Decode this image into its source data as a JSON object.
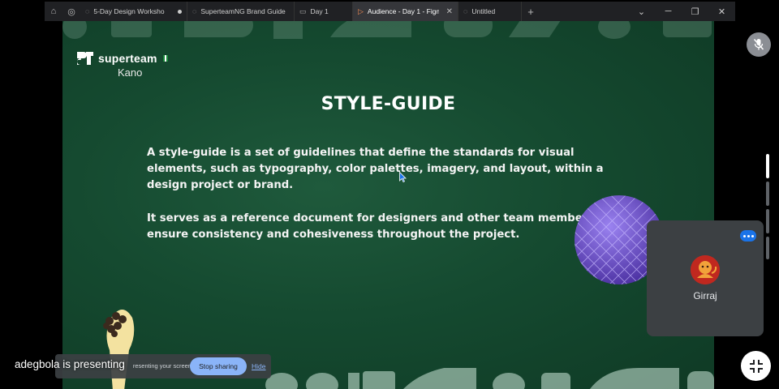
{
  "browser": {
    "tabs": [
      {
        "label": "5-Day Design Worksho",
        "icon": "globe-icon",
        "status": "loading"
      },
      {
        "label": "SuperteamNG Brand Guide",
        "icon": "globe-icon"
      },
      {
        "label": "Day 1",
        "icon": "document-icon"
      },
      {
        "label": "Audience - Day 1 - Figm",
        "icon": "figma-icon",
        "active": true
      },
      {
        "label": "Untitled",
        "icon": "globe-icon"
      }
    ],
    "new_tab_symbol": "+",
    "window_controls": [
      "⌄",
      "─",
      "❐",
      "✕"
    ]
  },
  "slide": {
    "brand": "superteam",
    "brand_sub": "Kano",
    "title": "STYLE-GUIDE",
    "paragraph1": "A style-guide is a set of guidelines that define the standards for visual elements, such as typography, color palettes, imagery, and layout, within a design project or brand.",
    "paragraph2": "It serves as a reference document for designers and other team members to ensure consistency and cohesiveness throughout the project.",
    "colors": {
      "background": "#154a30",
      "deco_shapes": "#cfe9db",
      "mesh_ball": "#7b5cd6",
      "flag_green": "#1b8a3c"
    }
  },
  "meet": {
    "participant_name": "Girraj",
    "presenting_text": "adegbola is presenting",
    "share_hint": "You're presenting your screen.",
    "stop_label": "Stop sharing",
    "hide_label": "Hide"
  }
}
